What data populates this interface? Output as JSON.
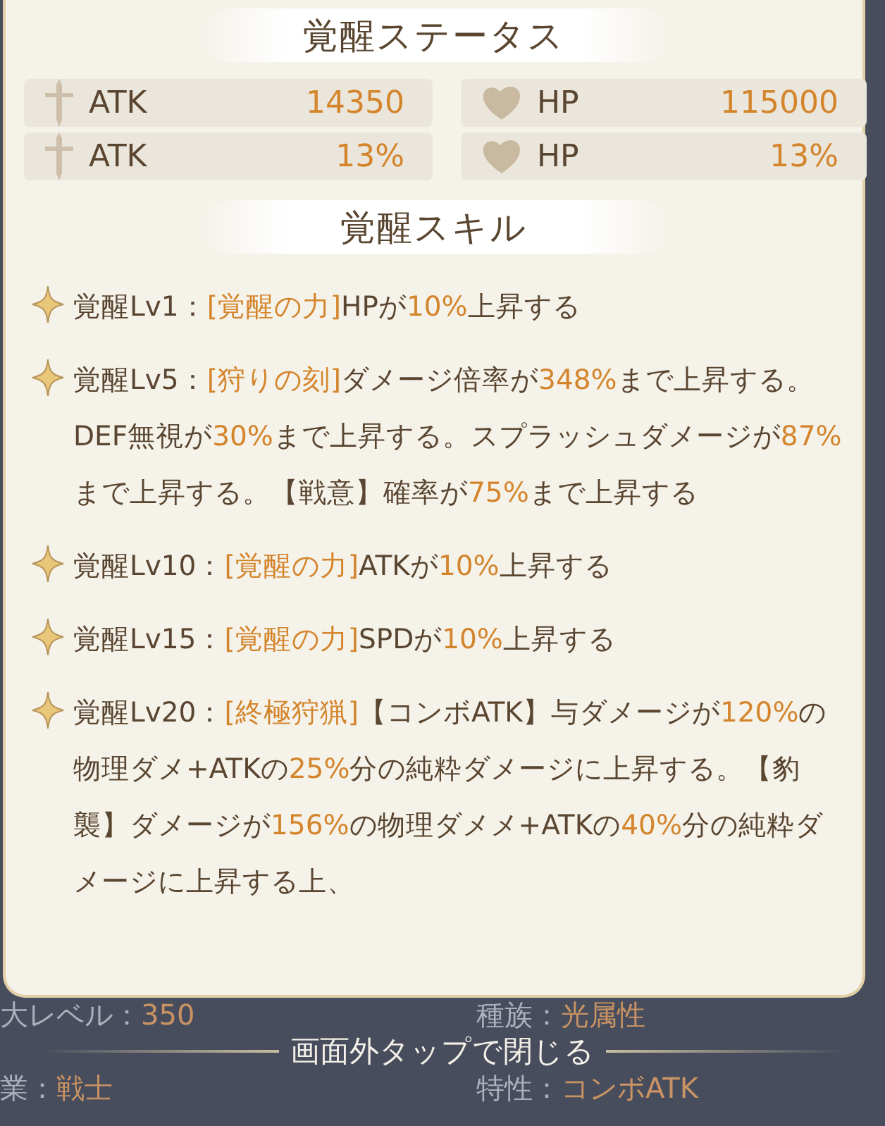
{
  "status_title": "覚醒ステータス",
  "stats": [
    {
      "kind": "atk",
      "label": "ATK",
      "value": "14350"
    },
    {
      "kind": "hp",
      "label": "HP",
      "value": "115000"
    },
    {
      "kind": "atk",
      "label": "ATK",
      "value": "13%"
    },
    {
      "kind": "hp",
      "label": "HP",
      "value": "13%"
    }
  ],
  "skills_title": "覚醒スキル",
  "skills": [
    {
      "segments": [
        {
          "text": "覚醒Lv1：",
          "highlight": false
        },
        {
          "text": "[覚醒の力]",
          "highlight": true
        },
        {
          "text": "HPが",
          "highlight": false
        },
        {
          "text": "10%",
          "highlight": true
        },
        {
          "text": "上昇する",
          "highlight": false
        }
      ]
    },
    {
      "segments": [
        {
          "text": "覚醒Lv5：",
          "highlight": false
        },
        {
          "text": "[狩りの刻]",
          "highlight": true
        },
        {
          "text": "ダメージ倍率が",
          "highlight": false
        },
        {
          "text": "348%",
          "highlight": true
        },
        {
          "text": "まで上昇する。DEF無視が",
          "highlight": false
        },
        {
          "text": "30%",
          "highlight": true
        },
        {
          "text": "まで上昇する。スプラッシュダメージが",
          "highlight": false
        },
        {
          "text": "87%",
          "highlight": true
        },
        {
          "text": "まで上昇する。【戦意】確率が",
          "highlight": false
        },
        {
          "text": "75%",
          "highlight": true
        },
        {
          "text": "まで上昇する",
          "highlight": false
        }
      ]
    },
    {
      "segments": [
        {
          "text": "覚醒Lv10：",
          "highlight": false
        },
        {
          "text": "[覚醒の力]",
          "highlight": true
        },
        {
          "text": "ATKが",
          "highlight": false
        },
        {
          "text": "10%",
          "highlight": true
        },
        {
          "text": "上昇する",
          "highlight": false
        }
      ]
    },
    {
      "segments": [
        {
          "text": "覚醒Lv15：",
          "highlight": false
        },
        {
          "text": "[覚醒の力]",
          "highlight": true
        },
        {
          "text": "SPDが",
          "highlight": false
        },
        {
          "text": "10%",
          "highlight": true
        },
        {
          "text": "上昇する",
          "highlight": false
        }
      ]
    },
    {
      "segments": [
        {
          "text": "覚醒Lv20：",
          "highlight": false
        },
        {
          "text": "[終極狩猟]",
          "highlight": true
        },
        {
          "text": "【コンボATK】与ダメージが",
          "highlight": false
        },
        {
          "text": "120%",
          "highlight": true
        },
        {
          "text": "の物理ダメ+ATKの",
          "highlight": false
        },
        {
          "text": "25%",
          "highlight": true
        },
        {
          "text": "分の純粋ダメージに上昇する。【豹襲】ダメージが",
          "highlight": false
        },
        {
          "text": "156%",
          "highlight": true
        },
        {
          "text": "の物理ダメメ+ATKの",
          "highlight": false
        },
        {
          "text": "40%",
          "highlight": true
        },
        {
          "text": "分の純粋ダメージに上昇する上、",
          "highlight": false
        }
      ]
    }
  ],
  "background": [
    {
      "label": "大レベル：",
      "value": "350"
    },
    {
      "label": "種族：",
      "value": "光属性"
    },
    {
      "label": "業：",
      "value": "戦士"
    },
    {
      "label": "特性：",
      "value": "コンボATK"
    }
  ],
  "close_hint": "画面外タップで閉じる"
}
